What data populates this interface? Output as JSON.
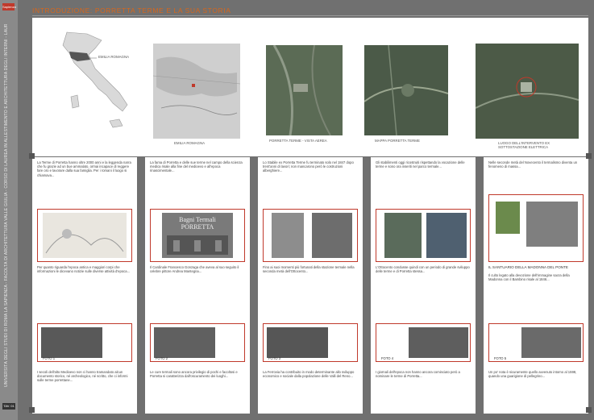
{
  "sidebar": {
    "logo_text": "Sapienza",
    "vertical_text": "UNIVERSITÀ DEGLI STUDI DI ROMA LA SAPIENZA - FACOLTÀ DI ARCHITETTURA VALLE GIULIA - CORSO DI LAUREA IN ALLESTIMENTO E ARCHITETTURA DEGLI INTERNI - LAUREANDA - RELATORE - CORRELATORE",
    "table_label": "TAV. 01"
  },
  "header": {
    "title": "INTRODUZIONE: PORRETTA TERME E LA SUA STORIA"
  },
  "top_row": {
    "map_label": "EMILIA ROMAGNA",
    "captions": [
      "EMILIA ROMAGNA",
      "PORRETTA TERME - VISTA AEREA",
      "MAPPA PORRETTA TERME",
      "LUOGO DELL'INTERVENTO EX SOTTOSTAZIONE ELETTRICA"
    ]
  },
  "columns": [
    {
      "text_top": "La Terme di Porretta hanno oltre 2000 anni e la leggenda narra che fu grazie ad un bue ammalato, ormai incapace di reggere fare oro e lavorare dalla sua famiglia. Per i romani il luogo si chiamava...",
      "text_mid": "Per quanto riguarda l'epoca antica e maggiori corpi che informazioni le dicevano notizie sulle diverse attività d'epoca...",
      "foto_label": "FOTO 1",
      "text_bottom": "I secoli dell'alto Medioevo non ci hanno tramandato alcun documento storico, né archeologico, né scritto, che ci informi sulle terme porrettane..."
    },
    {
      "text_top": "La fama di Porretta e delle sue terme nel campo della scienza medica risale alla fine del medioevo e all'epoca rinascimentale...",
      "sign_text": "Bagni Termali PORRETTA",
      "text_mid": "Il Cardinale Francesco Gonzaga che aveva al suo seguito il celebre pittore Andrea Mantegna...",
      "foto_label": "FOTO 2",
      "text_bottom": "Le cure termali sono ancora privilegio di pochi e facoltosi e Porretta si caratterizza dall'oscuramento dei luoghi..."
    },
    {
      "text_top": "Lo Stabile ex Porretta Terme fu terminato solo nel 1847 dopo trent'anni di lavori; non mancarono però le costruzioni alberghiere...",
      "text_mid": "Fino ai suoi momenti più fortunati della stazione termale nella seconda metà dell'Ottocento...",
      "foto_label": "FOTO 3",
      "text_bottom": "La Ferrovia ha contribuito in modo determinante allo sviluppo economico e sociale dalla popolazione delle Valli del Reno..."
    },
    {
      "text_top": "Gli stabilimenti oggi ricostruiti rispettando la vocazione delle terme e sono ora inseriti nel parco termale...",
      "text_mid": "L'Ottocento condusse quindi con un periodo di grande sviluppo delle terme e di Porretta stessa...",
      "foto_label": "FOTO 4",
      "text_bottom": "I giornali dell'epoca non hanno ancora cominciato però a nominare le terme di Porretta..."
    },
    {
      "text_top": "Nelle seconde metà del Novecento il termalismo diventa un fenomeno di massa...",
      "chapel_heading": "IL SANTUARIO DELLA MADONNA DEL PONTE",
      "text_mid": "Il culto legato alla devozione dell'immagine sacra della Madonna con il Bambino risale al 1846...",
      "foto_label": "FOTO 5",
      "text_bottom": "Un po' nota è sicuramente quello avvenuto intorno al 1598, quando una guarigione di pellegrino..."
    }
  ]
}
